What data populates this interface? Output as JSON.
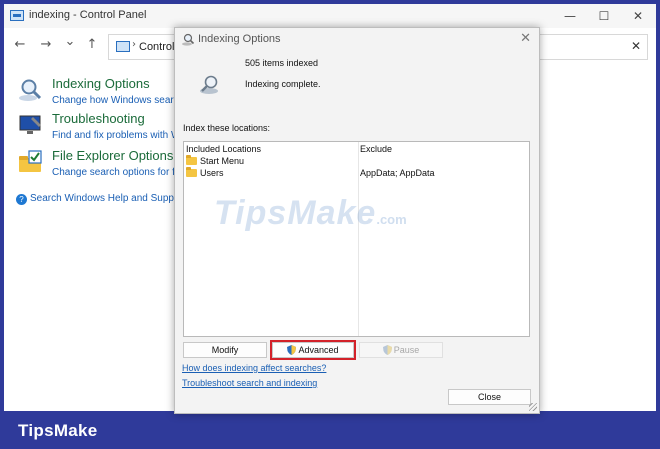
{
  "control_panel": {
    "title": "indexing - Control Panel",
    "window_controls": {
      "minimize": "—",
      "maximize": "☐",
      "close": "✕"
    },
    "nav": {
      "back": "←",
      "forward": "→",
      "recent": "⌄",
      "up": "↑"
    },
    "address": {
      "chevron": "›",
      "text": "Control P",
      "clear": "✕"
    },
    "items": [
      {
        "title": "Indexing Options",
        "subtitle": "Change how Windows searches"
      },
      {
        "title": "Troubleshooting",
        "subtitle": "Find and fix problems with Win"
      },
      {
        "title": "File Explorer Options",
        "subtitle": "Change search options for files"
      }
    ],
    "help_link": "Search Windows Help and Support f"
  },
  "dialog": {
    "title": "Indexing Options",
    "close": "✕",
    "items_indexed": "505 items indexed",
    "status": "Indexing complete.",
    "section_label": "Index these locations:",
    "columns": {
      "included": "Included Locations",
      "exclude": "Exclude"
    },
    "locations": [
      {
        "included": "Start Menu",
        "exclude": ""
      },
      {
        "included": "Users",
        "exclude": "AppData; AppData"
      }
    ],
    "watermark": {
      "main": "TipsMake",
      "suffix": ".com"
    },
    "buttons": {
      "modify": "Modify",
      "advanced": "Advanced",
      "pause": "Pause",
      "close": "Close"
    },
    "links": {
      "how_affect": "How does indexing affect searches?",
      "troubleshoot": "Troubleshoot search and indexing"
    }
  },
  "brand": "TipsMake",
  "colors": {
    "frame": "#2f3a9a",
    "highlight": "#d3222a",
    "link": "#1a5fb4",
    "cp_title": "#1b6b3a"
  }
}
